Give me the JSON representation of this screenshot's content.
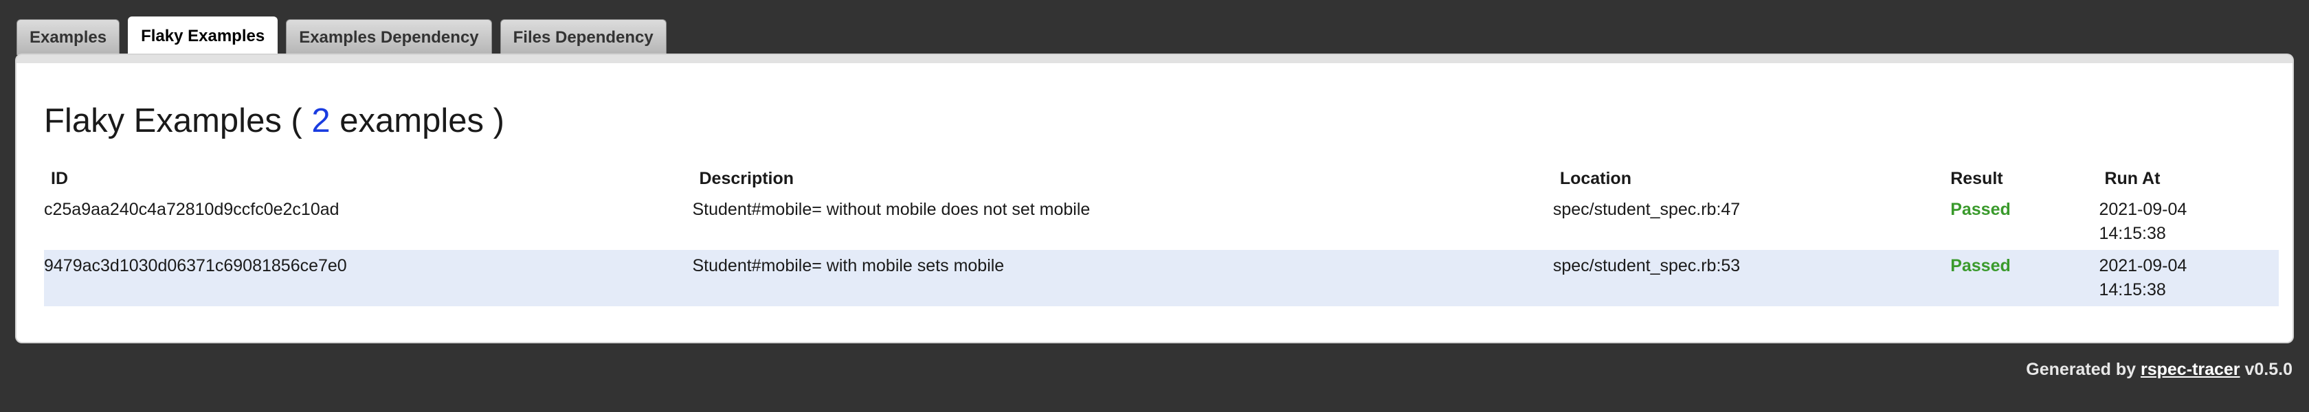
{
  "tabs": [
    {
      "label": "Examples",
      "active": false
    },
    {
      "label": "Flaky Examples",
      "active": true
    },
    {
      "label": "Examples Dependency",
      "active": false
    },
    {
      "label": "Files Dependency",
      "active": false
    }
  ],
  "page": {
    "title_prefix": "Flaky Examples (",
    "count": "2",
    "title_suffix": "examples )"
  },
  "table": {
    "headers": {
      "id": "ID",
      "description": "Description",
      "location": "Location",
      "result": "Result",
      "run_at": "Run At"
    },
    "rows": [
      {
        "id": "c25a9aa240c4a72810d9ccfc0e2c10ad",
        "description": "Student#mobile= without mobile does not set mobile",
        "location": "spec/student_spec.rb:47",
        "result": "Passed",
        "run_at_date": "2021-09-04",
        "run_at_time": "14:15:38"
      },
      {
        "id": "9479ac3d1030d06371c69081856ce7e0",
        "description": "Student#mobile= with mobile sets mobile",
        "location": "spec/student_spec.rb:53",
        "result": "Passed",
        "run_at_date": "2021-09-04",
        "run_at_time": "14:15:38"
      }
    ]
  },
  "footer": {
    "prefix": "Generated by",
    "link": "rspec-tracer",
    "version": "v0.5.0"
  },
  "colors": {
    "background": "#333333",
    "passed": "#3a9a2c",
    "count": "#1a3ce0",
    "alt_row": "#e4ebf8"
  }
}
